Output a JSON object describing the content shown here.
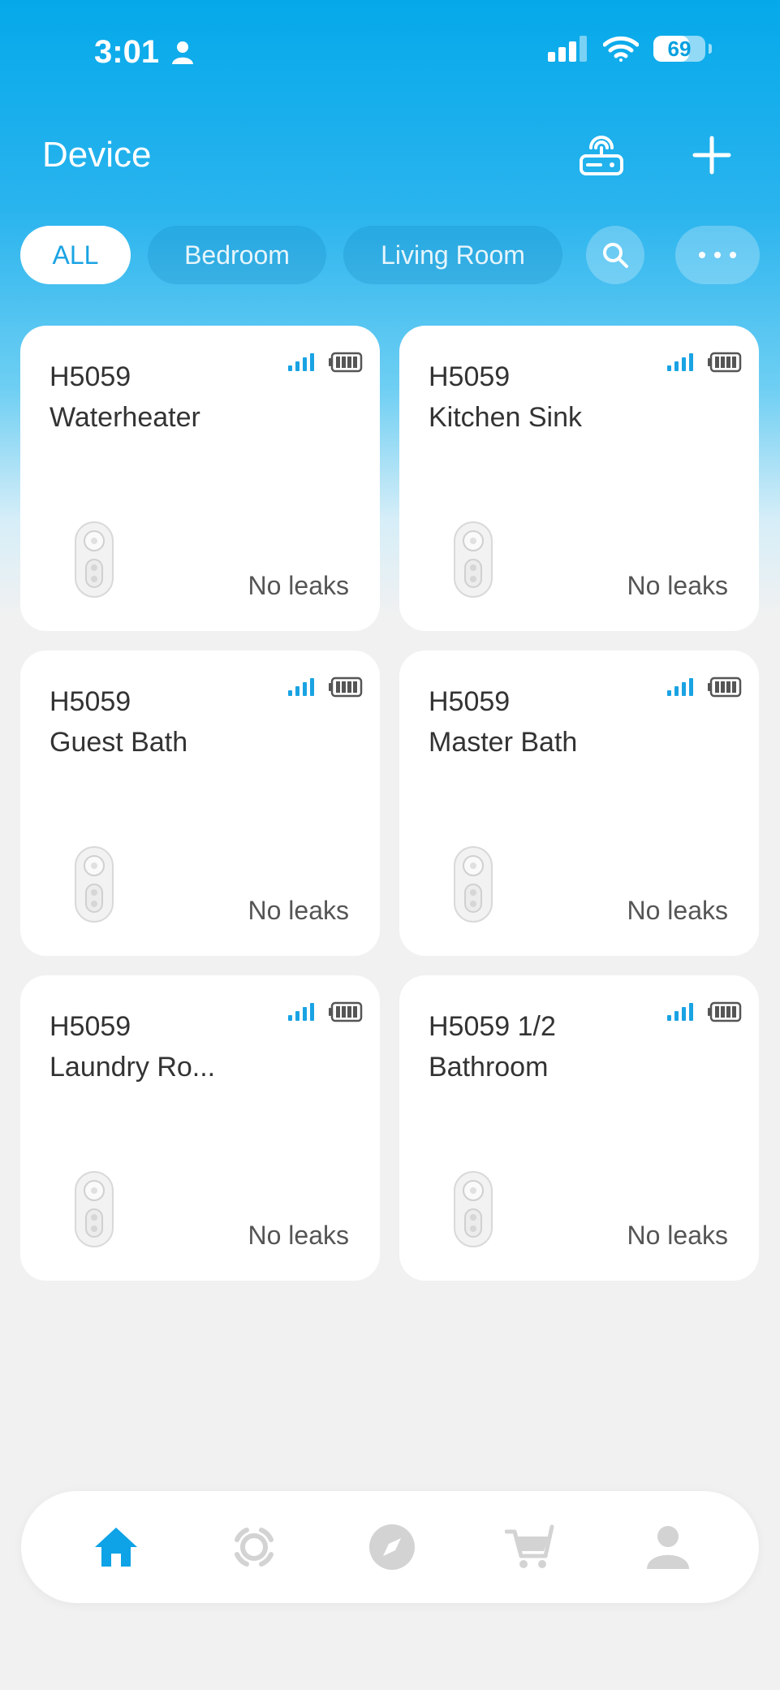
{
  "status_bar": {
    "time": "3:01",
    "battery_percent": "69",
    "battery_level": 0.69
  },
  "header": {
    "title": "Device",
    "hub_icon": "hub-router-icon",
    "add_icon": "plus-icon"
  },
  "filters": {
    "chips": [
      "ALL",
      "Bedroom",
      "Living Room"
    ],
    "active": "ALL",
    "search_icon": "search-icon",
    "more_icon": "more-dots-icon"
  },
  "devices": [
    {
      "model": "H5059",
      "name": "Waterheater",
      "status": "No leaks"
    },
    {
      "model": "H5059",
      "name": "Kitchen Sink",
      "status": "No leaks"
    },
    {
      "model": "H5059",
      "name": "Guest Bath",
      "status": "No leaks"
    },
    {
      "model": "H5059",
      "name": "Master Bath",
      "status": "No leaks"
    },
    {
      "model": "H5059",
      "name": "Laundry Ro...",
      "status": "No leaks"
    },
    {
      "model": "H5059 1/2",
      "name": "Bathroom",
      "status": "No leaks"
    }
  ],
  "tabbar": {
    "tabs": [
      "home-icon",
      "scenes-icon",
      "discover-compass-icon",
      "shop-cart-icon",
      "profile-icon"
    ],
    "active": "home-icon"
  },
  "colors": {
    "accent": "#1aa3e3",
    "header_blue": "#05a9ea",
    "inactive_icon": "#cfcfcf"
  }
}
